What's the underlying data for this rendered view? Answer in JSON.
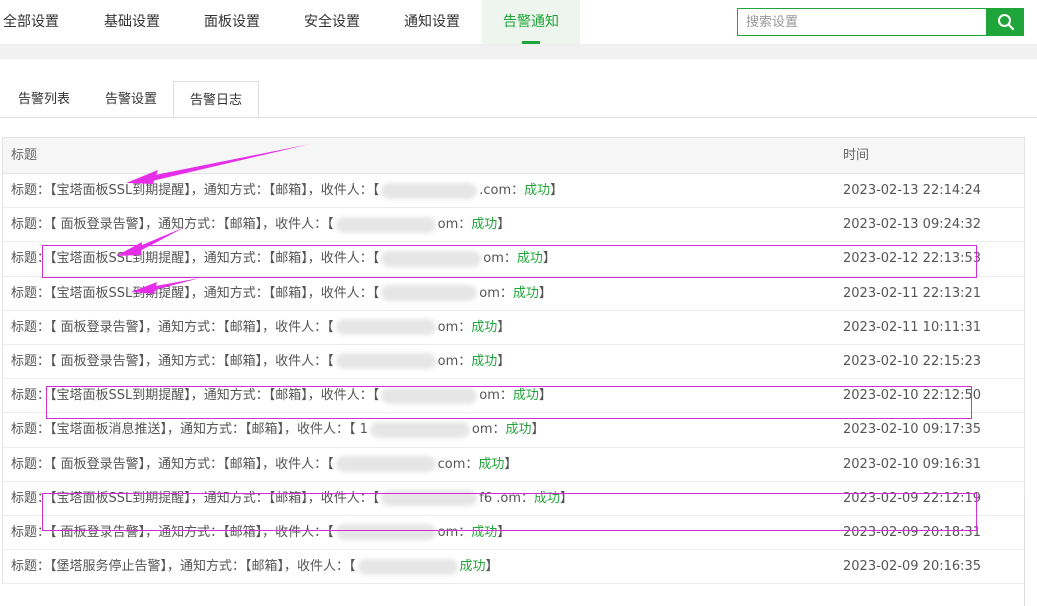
{
  "nav": {
    "tabs": [
      "全部设置",
      "基础设置",
      "面板设置",
      "安全设置",
      "通知设置",
      "告警通知"
    ],
    "active_index": 5
  },
  "search": {
    "placeholder": "搜索设置",
    "icon": "search-icon"
  },
  "subtabs": {
    "items": [
      "告警列表",
      "告警设置",
      "告警日志"
    ],
    "active_index": 2
  },
  "table": {
    "headers": {
      "title": "标题",
      "time": "时间"
    },
    "rows": [
      {
        "pre": "标题：【宝塔面板SSL到期提醒】，通知方式：【邮箱】，收件人：【",
        "tail": ".com：",
        "status": "成功",
        "end": "】",
        "time": "2023-02-13 22:14:24"
      },
      {
        "pre": "标题：【 面板登录告警】，通知方式：【邮箱】，收件人：【",
        "tail": "om：",
        "status": "成功",
        "end": "】",
        "time": "2023-02-13 09:24:32"
      },
      {
        "pre": "标题：【宝塔面板SSL到期提醒】，通知方式：【邮箱】，收件人：【",
        "tail": "om：",
        "status": "成功",
        "end": "】",
        "time": "2023-02-12 22:13:53"
      },
      {
        "pre": "标题：【宝塔面板SSL到期提醒】，通知方式：【邮箱】，收件人：【",
        "tail": "om：",
        "status": "成功",
        "end": "】",
        "time": "2023-02-11 22:13:21"
      },
      {
        "pre": "标题：【 面板登录告警】，通知方式：【邮箱】，收件人：【",
        "tail": "om：",
        "status": "成功",
        "end": "】",
        "time": "2023-02-11 10:11:31"
      },
      {
        "pre": "标题：【 面板登录告警】，通知方式：【邮箱】，收件人：【",
        "tail": "om：",
        "status": "成功",
        "end": "】",
        "time": "2023-02-10 22:15:23"
      },
      {
        "pre": "标题：【宝塔面板SSL到期提醒】，通知方式：【邮箱】，收件人：【",
        "tail": "om：",
        "status": "成功",
        "end": "】",
        "time": "2023-02-10 22:12:50"
      },
      {
        "pre": "标题：【宝塔面板消息推送】，通知方式：【邮箱】，收件人：【 1",
        "tail": "om：",
        "status": "成功",
        "end": "】",
        "time": "2023-02-10 09:17:35"
      },
      {
        "pre": "标题：【 面板登录告警】，通知方式：【邮箱】，收件人：【",
        "tail": "com：",
        "status": "成功",
        "end": "】",
        "time": "2023-02-10 09:16:31"
      },
      {
        "pre": "标题：【宝塔面板SSL到期提醒】，通知方式：【邮箱】，收件人：【",
        "tail": "f6 .om：",
        "status": "成功",
        "end": "】",
        "time": "2023-02-09 22:12:19"
      },
      {
        "pre": "标题：【 面板登录告警】，通知方式：【邮箱】，收件人：【",
        "tail": "om：",
        "status": "成功",
        "end": "】",
        "time": "2023-02-09 20:18:31"
      },
      {
        "pre": "标题：【堡塔服务停止告警】，通知方式：【邮箱】，收件人：【",
        "tail": "",
        "status": "成功",
        "end": "】",
        "time": "2023-02-09 20:16:35"
      }
    ]
  },
  "colors": {
    "accent": "#20a53a",
    "highlight": "#d22ed5"
  }
}
